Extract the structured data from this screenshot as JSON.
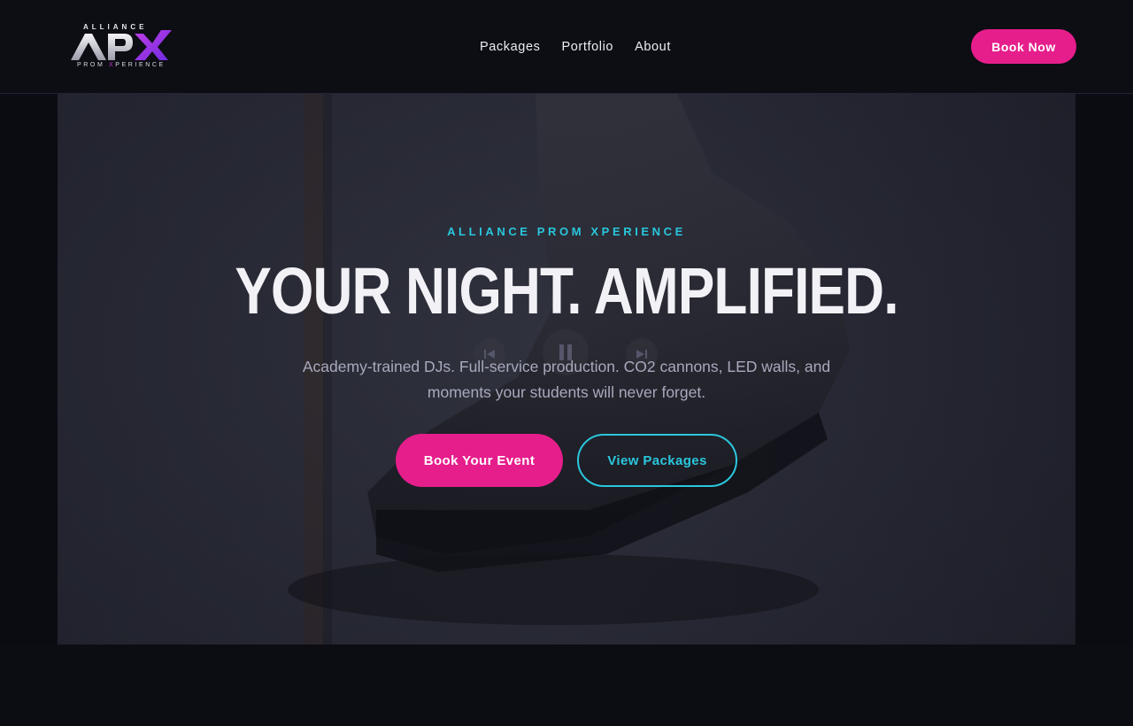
{
  "brand": {
    "logo_top": "ALLIANCE",
    "logo_mark": "APX",
    "logo_bottom_pre": "PROM ",
    "logo_bottom_x": "X",
    "logo_bottom_post": "PERIENCE",
    "accent_pink": "#e61e8c",
    "accent_cyan": "#2bc7dd",
    "accent_purple": "#8a2be2"
  },
  "nav": {
    "items": [
      {
        "label": "Packages"
      },
      {
        "label": "Portfolio"
      },
      {
        "label": "About"
      }
    ],
    "cta_label": "Book Now"
  },
  "hero": {
    "eyebrow": "ALLIANCE PROM XPERIENCE",
    "headline": "YOUR NIGHT. AMPLIFIED.",
    "subtext": "Academy-trained DJs. Full-service production. CO2 cannons, LED walls, and moments your students will never forget.",
    "primary_cta": "Book Your Event",
    "secondary_cta": "View Packages",
    "video_controls": {
      "prev_icon": "skip-back-icon",
      "pause_icon": "pause-icon",
      "next_icon": "skip-forward-icon"
    }
  }
}
